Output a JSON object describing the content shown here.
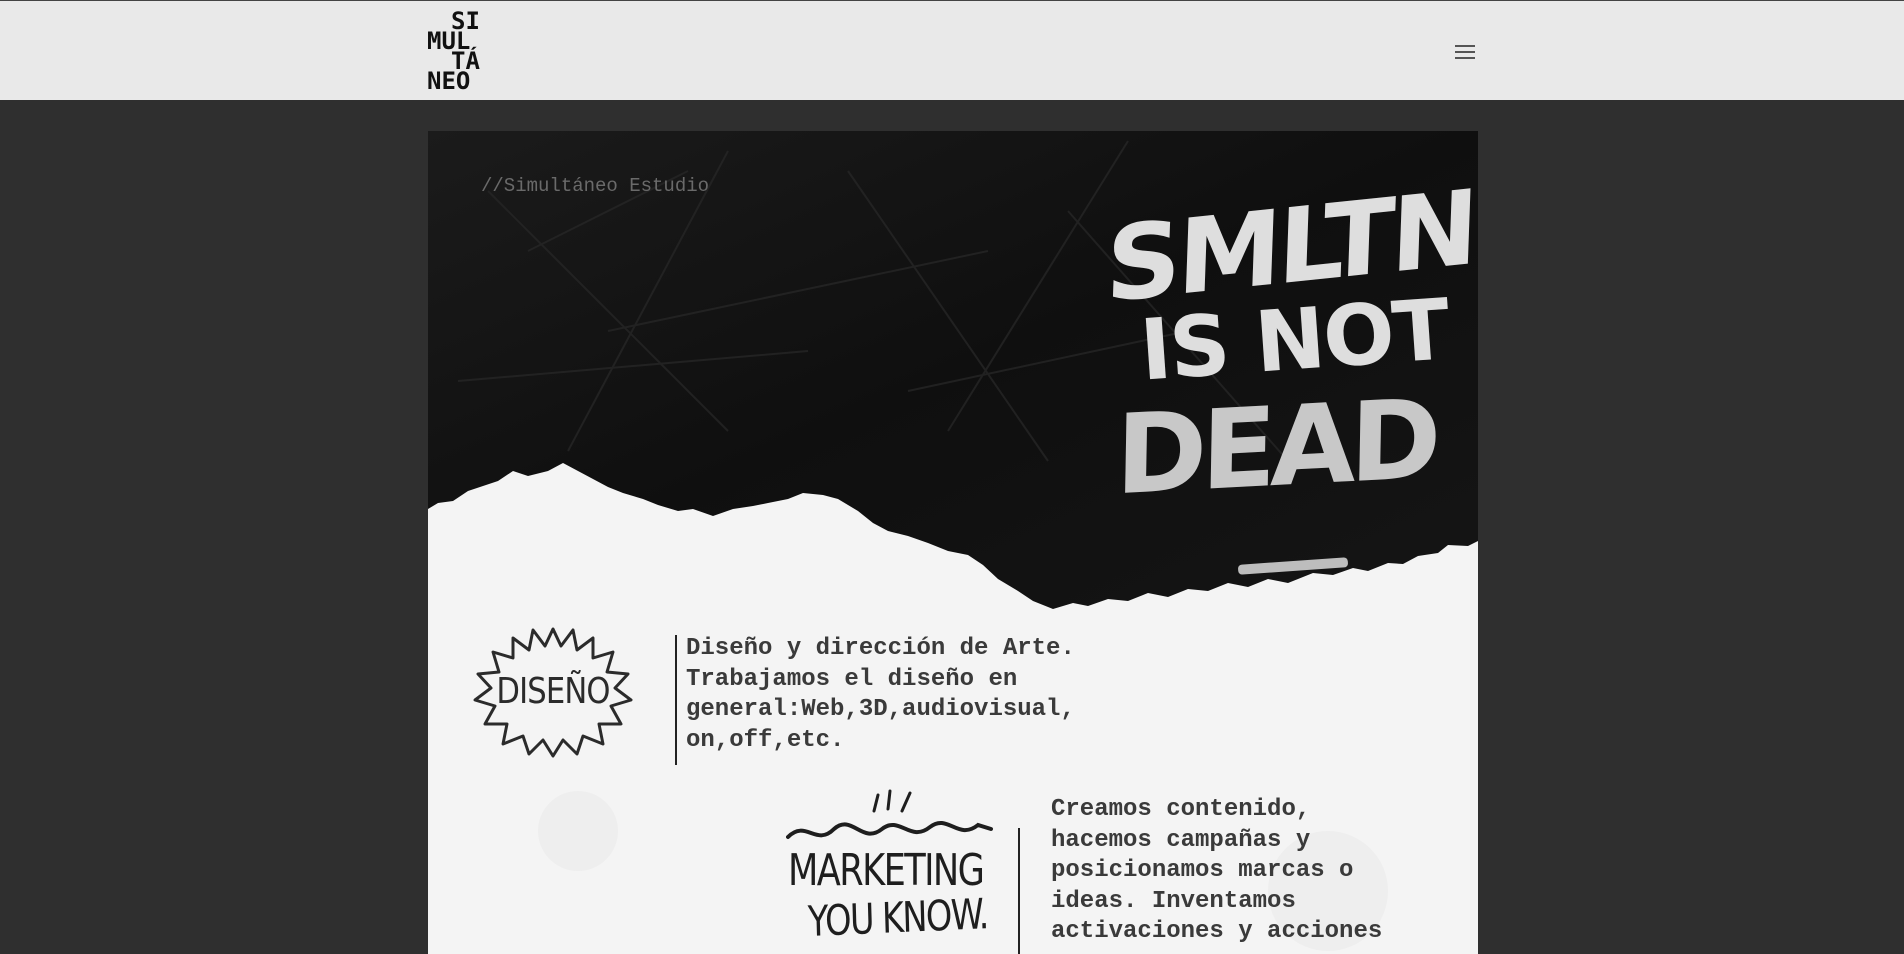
{
  "header": {
    "logo_lines": [
      "SI",
      "MUL",
      "TÁ",
      "NEO"
    ],
    "menu_icon": "hamburger-menu-icon"
  },
  "hero": {
    "studio_tag": "//Simultáneo Estudio",
    "graffiti": {
      "line1": "SMLTNQ",
      "line2": "IS NOT",
      "line3": "DEAD"
    }
  },
  "services": [
    {
      "badge": "DISEÑO",
      "text": "Diseño y dirección de Arte.\nTrabajamos el diseño en\ngeneral:Web,3D,audiovisual,\non,off,etc."
    },
    {
      "badge_line1": "MARKETING",
      "badge_line2": "YOU KNOW.",
      "text": "Creamos contenido,\nhacemos campañas y\nposicionamos marcas o\nideas. Inventamos\nactivaciones y acciones"
    }
  ],
  "colors": {
    "page_bg": "#2f2f2f",
    "header_bg": "#e9e9e9",
    "hero_dark": "#111111",
    "paper": "#f4f4f4"
  }
}
